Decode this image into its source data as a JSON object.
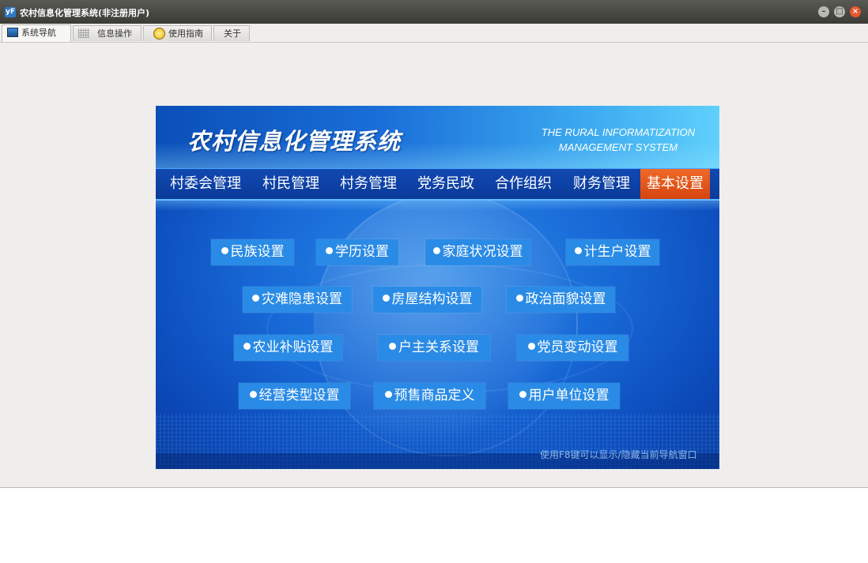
{
  "window": {
    "title": "农村信息化管理系统(非注册用户)",
    "app_icon_text": "yF"
  },
  "tabs": [
    {
      "label": "系统导航",
      "icon": "monitor-icon",
      "active": true
    },
    {
      "label": "信息操作",
      "icon": "grid-icon",
      "active": false
    },
    {
      "label": "使用指南",
      "icon": "help-icon",
      "active": false
    },
    {
      "label": "关于",
      "icon": "",
      "active": false
    }
  ],
  "banner": {
    "title_cn": "农村信息化管理系统",
    "title_en_line1": "THE RURAL INFORMATIZATION",
    "title_en_line2": "MANAGEMENT SYSTEM",
    "hint": "使用F8键可以显示/隐藏当前导航窗口"
  },
  "nav": [
    {
      "label": "村委会管理"
    },
    {
      "label": "村民管理"
    },
    {
      "label": "村务管理"
    },
    {
      "label": "党务民政"
    },
    {
      "label": "合作组织"
    },
    {
      "label": "财务管理"
    },
    {
      "label": "基本设置",
      "active": true
    }
  ],
  "settings_buttons": [
    {
      "label": "民族设置"
    },
    {
      "label": "学历设置"
    },
    {
      "label": "家庭状况设置"
    },
    {
      "label": "计生户设置"
    },
    {
      "label": "灾难隐患设置"
    },
    {
      "label": "房屋结构设置"
    },
    {
      "label": "政治面貌设置"
    },
    {
      "label": "农业补贴设置"
    },
    {
      "label": "户主关系设置"
    },
    {
      "label": "党员变动设置"
    },
    {
      "label": "经营类型设置"
    },
    {
      "label": "预售商品定义"
    },
    {
      "label": "用户单位设置"
    }
  ],
  "colors": {
    "banner_blue": "#1768d6",
    "nav_bg": "#0a3a9a",
    "nav_active": "#e0561a",
    "button_bg": "#2a8be6",
    "close_button": "#e9562c"
  }
}
